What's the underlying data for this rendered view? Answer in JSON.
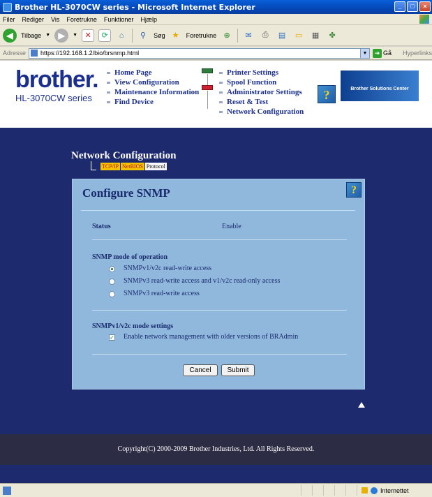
{
  "window": {
    "title": "Brother HL-3070CW series - Microsoft Internet Explorer"
  },
  "menu": [
    "Filer",
    "Rediger",
    "Vis",
    "Foretrukne",
    "Funktioner",
    "Hjælp"
  ],
  "toolbar": {
    "back_label": "Tilbage",
    "search_label": "Søg",
    "favorites_label": "Foretrukne"
  },
  "address": {
    "label": "Adresse",
    "url": "https://192.168.1.2/bio/brsnmp.html",
    "go_label": "Gå",
    "links_label": "Hyperlinks"
  },
  "header": {
    "logo": "brother.",
    "model": "HL-3070CW series",
    "nav_left": [
      "Home Page",
      "View Configuration",
      "Maintenance Information",
      "Find Device"
    ],
    "nav_right": [
      "Printer Settings",
      "Spool Function",
      "Administrator Settings",
      "Reset & Test",
      "Network Configuration"
    ],
    "solutions_label": "Brother Solutions Center"
  },
  "section": {
    "title": "Network Configuration",
    "tabs": [
      {
        "label": "TCP/IP",
        "active": true
      },
      {
        "label": "NetBIOS",
        "active": true
      },
      {
        "label": "Protocol",
        "active": false
      }
    ]
  },
  "panel": {
    "title": "Configure SNMP",
    "status_label": "Status",
    "status_value": "Enable",
    "mode_heading": "SNMP mode of operation",
    "modes": [
      {
        "label": "SNMPv1/v2c read-write access",
        "checked": true
      },
      {
        "label": "SNMPv3 read-write access and v1/v2c read-only access",
        "checked": false
      },
      {
        "label": "SNMPv3 read-write access",
        "checked": false
      }
    ],
    "v1v2c_heading": "SNMPv1/v2c mode settings",
    "checkbox_label": "Enable network management with older versions of BRAdmin",
    "checkbox_checked": true,
    "cancel_label": "Cancel",
    "submit_label": "Submit"
  },
  "footer": {
    "copyright": "Copyright(C) 2000-2009 Brother Industries, Ltd. All Rights Reserved."
  },
  "statusbar": {
    "zone": "Internettet"
  }
}
